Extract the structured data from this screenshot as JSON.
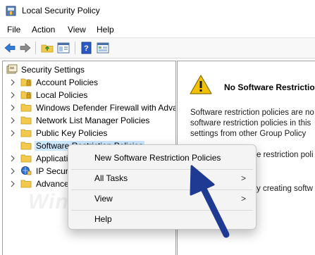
{
  "window": {
    "title": "Local Security Policy"
  },
  "menu": {
    "items": [
      "File",
      "Action",
      "View",
      "Help"
    ]
  },
  "toolbar": {
    "buttons": [
      "back-icon",
      "forward-icon",
      "up-folder-icon",
      "show-hide-tree-icon",
      "help-icon",
      "properties-icon"
    ]
  },
  "tree": {
    "root": "Security Settings",
    "items": [
      {
        "label": "Account Policies",
        "icon": "policy-folder-icon"
      },
      {
        "label": "Local Policies",
        "icon": "policy-folder-icon"
      },
      {
        "label": "Windows Defender Firewall with Adva",
        "icon": "folder-icon"
      },
      {
        "label": "Network List Manager Policies",
        "icon": "folder-icon"
      },
      {
        "label": "Public Key Policies",
        "icon": "folder-icon"
      },
      {
        "label": "Software Restriction Policies",
        "icon": "folder-icon",
        "selected": true
      },
      {
        "label": "Applicatio",
        "icon": "folder-icon"
      },
      {
        "label": "IP Securit",
        "icon": "ip-security-icon"
      },
      {
        "label": "Advance",
        "icon": "folder-icon"
      }
    ]
  },
  "right_pane": {
    "title": "No Software Restriction",
    "lines": [
      "Software restriction policies are no",
      "software restriction policies in this",
      "settings from other Group Policy"
    ],
    "line2": "e restriction poli",
    "line3": "y creating softw"
  },
  "context_menu": {
    "items": [
      {
        "label": "New Software Restriction Policies",
        "submenu": false
      },
      {
        "label": "All Tasks",
        "submenu": true
      },
      {
        "label": "View",
        "submenu": true
      },
      {
        "label": "Help",
        "submenu": false
      }
    ],
    "arrow_glyph": ">"
  },
  "watermark": "WindowsLoop.com",
  "colors": {
    "selection": "#cce8ff",
    "annotation_arrow": "#1f3a93",
    "warning": "#f2c200"
  }
}
